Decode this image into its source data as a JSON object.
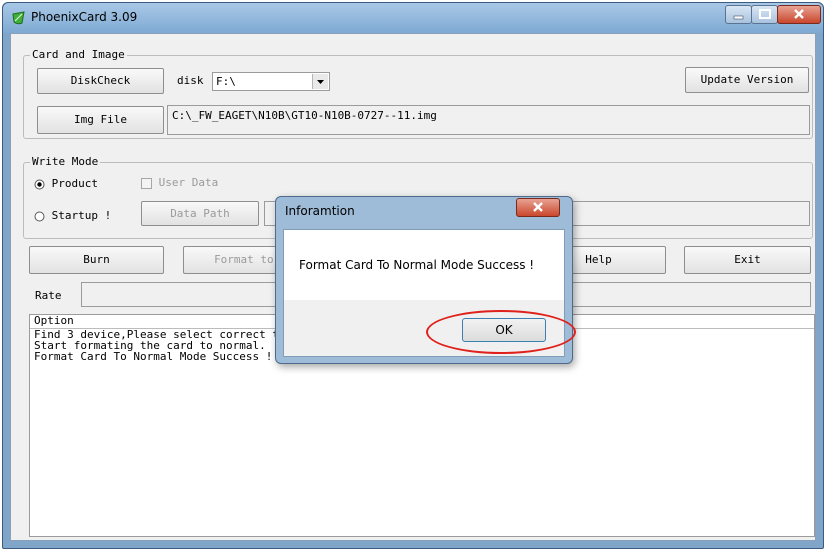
{
  "window": {
    "title": "PhoenixCard 3.09"
  },
  "card_image": {
    "group_label": "Card and Image",
    "diskcheck_label": "DiskCheck",
    "disk_label": "disk",
    "disk_value": "F:\\",
    "update_label": "Update Version",
    "imgfile_label": "Img File",
    "img_path": "C:\\_FW_EAGET\\N10B\\GT10-N10B-0727--11.img"
  },
  "write_mode": {
    "group_label": "Write Mode",
    "product_label": "Product",
    "startup_label": "Startup !",
    "userdata_label": "User Data",
    "datapath_label": "Data Path"
  },
  "actions": {
    "burn_label": "Burn",
    "format_label": "Format to N",
    "help_label": "Help",
    "exit_label": "Exit"
  },
  "rate": {
    "label": "Rate"
  },
  "option": {
    "header": "Option",
    "lines": [
      "Find 3 device,Please select correct t",
      "Start formating the card to normal.",
      "Format Card To Normal Mode Success !"
    ]
  },
  "dialog": {
    "title": "Inforamtion",
    "message": "Format Card To Normal Mode Success !",
    "ok_label": "OK"
  },
  "colors": {
    "annotation_circle": "#e0211b",
    "window_frame": "#7fa6c9"
  },
  "icons": {
    "app": "phoenix-leaf-icon",
    "dropdown": "chevron-down-icon"
  }
}
